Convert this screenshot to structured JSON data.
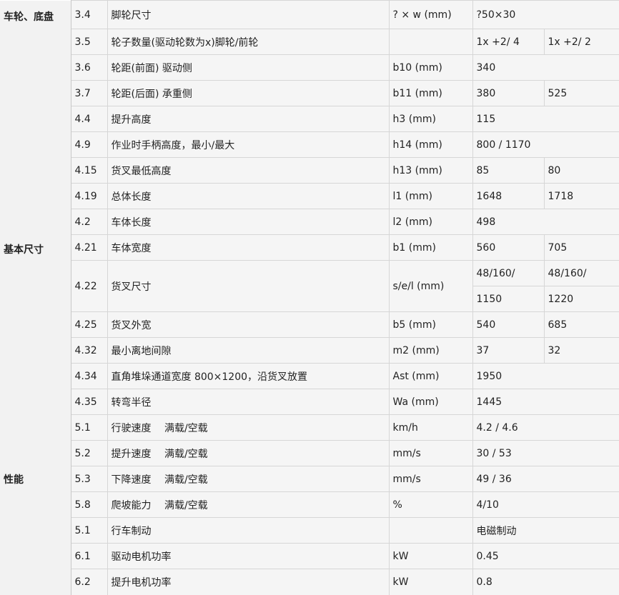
{
  "categories": {
    "wheels": "车轮、底盘",
    "dimensions": "基本尺寸",
    "performance": "性能"
  },
  "rows": [
    {
      "code": "3.4",
      "desc": "脚轮尺寸",
      "unit": "? × w (mm)",
      "v1": "?50×30",
      "v2": ""
    },
    {
      "code": "3.5",
      "desc": "轮子数量(驱动轮数为x)脚轮/前轮",
      "unit": "",
      "v1": "1x +2/ 4",
      "v2": "1x +2/ 2"
    },
    {
      "code": "3.6",
      "desc": "轮距(前面) 驱动侧",
      "unit": "b10 (mm)",
      "v1": "340",
      "v2": ""
    },
    {
      "code": "3.7",
      "desc": "轮距(后面) 承重侧",
      "unit": "b11 (mm)",
      "v1": "380",
      "v2": "525"
    },
    {
      "code": "4.4",
      "desc": "提升高度",
      "unit": "h3 (mm)",
      "v1": "115",
      "v2": ""
    },
    {
      "code": "4.9",
      "desc": "作业时手柄高度，最小/最大",
      "unit": "h14 (mm)",
      "v1": "800 / 1170",
      "v2": ""
    },
    {
      "code": "4.15",
      "desc": "货叉最低高度",
      "unit": "h13 (mm)",
      "v1": "85",
      "v2": "80"
    },
    {
      "code": "4.19",
      "desc": "总体长度",
      "unit": "l1 (mm)",
      "v1": "1648",
      "v2": "1718"
    },
    {
      "code": "4.2",
      "desc": "车体长度",
      "unit": "l2 (mm)",
      "v1": "498",
      "v2": ""
    },
    {
      "code": "4.21",
      "desc": "车体宽度",
      "unit": "b1 (mm)",
      "v1": "560",
      "v2": "705"
    },
    {
      "code": "4.22",
      "desc": "货叉尺寸",
      "unit": "s/e/l (mm)",
      "v1": "48/160/",
      "v2": "48/160/",
      "v1b": "1150",
      "v2b": "1220"
    },
    {
      "code": "4.25",
      "desc": "货叉外宽",
      "unit": "b5 (mm)",
      "v1": "540",
      "v2": "685"
    },
    {
      "code": "4.32",
      "desc": "最小离地间隙",
      "unit": "m2 (mm)",
      "v1": "37",
      "v2": "32"
    },
    {
      "code": "4.34",
      "desc": "直角堆垛通道宽度 800×1200，沿货叉放置",
      "unit": "Ast (mm)",
      "v1": "1950",
      "v2": ""
    },
    {
      "code": "4.35",
      "desc": "转弯半径",
      "unit": "Wa (mm)",
      "v1": "1445",
      "v2": ""
    },
    {
      "code": "5.1",
      "desc": "行驶速度　 满载/空载",
      "unit": "km/h",
      "v1": "4.2 / 4.6",
      "v2": ""
    },
    {
      "code": "5.2",
      "desc": "提升速度　 满载/空载",
      "unit": "mm/s",
      "v1": "30 / 53",
      "v2": ""
    },
    {
      "code": "5.3",
      "desc": "下降速度　 满载/空载",
      "unit": "mm/s",
      "v1": "49 / 36",
      "v2": ""
    },
    {
      "code": "5.8",
      "desc": "爬坡能力　 满载/空载",
      "unit": "%",
      "v1": "4/10",
      "v2": ""
    },
    {
      "code": "5.1",
      "desc": "行车制动",
      "unit": "",
      "v1": "电磁制动",
      "v2": ""
    },
    {
      "code": "6.1",
      "desc": "驱动电机功率",
      "unit": "kW",
      "v1": "0.45",
      "v2": ""
    },
    {
      "code": "6.2",
      "desc": "提升电机功率",
      "unit": "kW",
      "v1": "0.8",
      "v2": ""
    }
  ]
}
